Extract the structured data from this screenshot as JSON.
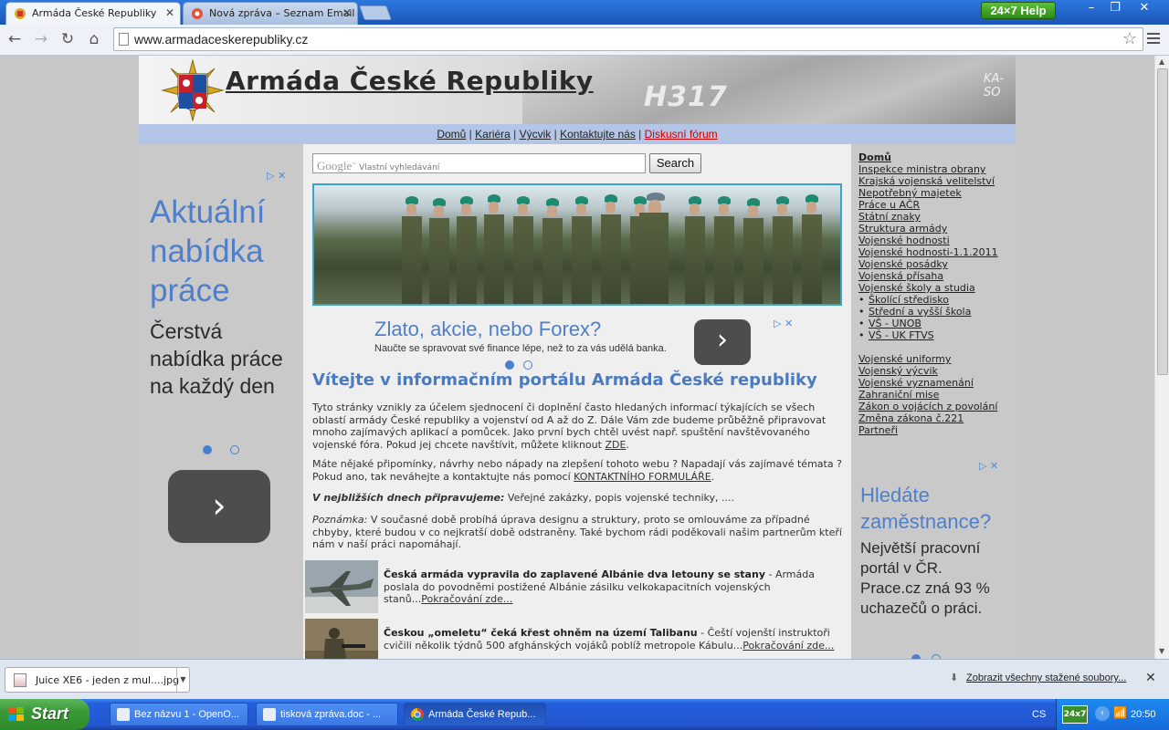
{
  "browser": {
    "tabs": [
      {
        "title": "Armáda České Republiky",
        "active": true
      },
      {
        "title": "Nová zpráva – Seznam Email",
        "active": false
      }
    ],
    "help_badge": "24×7 Help",
    "url": "www.armadaceskerepubliky.cz"
  },
  "site": {
    "title": "Armáda České Republiky",
    "header_marking": "H317",
    "header_marking2": "KA-SO",
    "nav": [
      "Domů",
      "Kariéra",
      "Výcvik",
      "Kontaktujte nás",
      "Diskusní fórum"
    ],
    "search_placeholder": "Vlastní vyhledávání",
    "search_brand": "Google",
    "search_button": "Search"
  },
  "ads": {
    "left": {
      "title": "Aktuální nabídka práce",
      "text": "Čerstvá nabídka práce na každý den"
    },
    "center": {
      "title": "Zlato, akcie, nebo Forex?",
      "text": "Naučte se spravovat své finance lépe, než to za vás udělá banka."
    },
    "right": {
      "title": "Hledáte zaměstnance?",
      "text": "Největší pracovní portál v ČR. Prace.cz zná 93 % uchazečů o práci."
    }
  },
  "main": {
    "welcome": "Vítejte v informačním portálu Armáda České republiky",
    "p1": "Tyto stránky vznikly za účelem sjednocení či doplnění často hledaných informací týkajících se všech oblastí armády České republiky a vojenství od A až do Z. Dále Vám zde budeme průběžně připravovat mnoho zajímavých aplikací a pomůcek. Jako první bych chtěl uvést např. spuštění navštěvovaného vojenské fóra. Pokud jej chcete navštívit, můžete kliknout ",
    "p1_link": "ZDE",
    "p2": "Máte nějaké připomínky, návrhy nebo nápady na zlepšení tohoto webu ? Napadají vás zajímavé témata ? Pokud ano, tak neváhejte a kontaktujte nás pomocí ",
    "p2_link": "KONTAKTNÍHO FORMULÁŘE",
    "p3_label": "V nejbližších dnech připravujeme:",
    "p3": " Veřejné zakázky, popis vojenské techniky, ....",
    "p4_label": "Poznámka:",
    "p4": " V současné době probíhá úprava designu a struktury, proto se omlouváme za případné chbyby, které budou v co nejkratší době odstraněny. Také bychom rádi poděkovali našim partnerům kteří nám v naší práci napomáhají.",
    "news": [
      {
        "title": "Česká armáda vypravila do zaplavené Albánie dva letouny se stany",
        "text": " - Armáda poslala do povodněmi postižené Albánie zásilku velkokapacitních vojenských stanů...",
        "more": "Pokračování zde..."
      },
      {
        "title": "Českou „omeletu“ čeká křest ohněm na území Talibanu",
        "text": " - Čeští vojenští instruktoři cvičili několik týdnů 500 afghánských vojáků poblíž metropole Kábulu...",
        "more": "Pokračování zde..."
      }
    ]
  },
  "sidebar": {
    "home": "Domů",
    "links": [
      "Inspekce ministra obrany",
      "Krajská vojenská velitelství",
      "Nepotřebný majetek",
      "Práce u AČR",
      "Státní znaky",
      "Struktura armády",
      "Vojenské hodnosti",
      "Vojenské hodnosti-1.1.2011",
      "Vojenské posádky",
      "Vojenská přísaha",
      "Vojenské školy a studia"
    ],
    "sublinks": [
      "Školící středisko",
      "Střední a vyšší škola",
      "VŠ - UNOB",
      "VŠ - UK FTVS"
    ],
    "links2": [
      "Vojenské uniformy",
      "Vojenský výcvik",
      "Vojenské vyznamenání",
      "Zahraniční mise",
      "Zákon o vojácích z povolání",
      "Změna zákona č.221",
      "Partneři"
    ]
  },
  "downloads": {
    "file": "Juice XE6 - jeden z mul....jpg",
    "show_all": "Zobrazit všechny stažené soubory..."
  },
  "taskbar": {
    "start": "Start",
    "tasks": [
      "Bez názvu 1 - OpenO...",
      "tisková zpráva.doc - ...",
      "Armáda České Repub..."
    ],
    "lang": "CS",
    "tray_badge": "24x7",
    "clock": "20:50"
  },
  "colors": {
    "accent": "#4f7fc9",
    "nav_bg": "#b3c6e7",
    "taskbar": "#245edb"
  }
}
